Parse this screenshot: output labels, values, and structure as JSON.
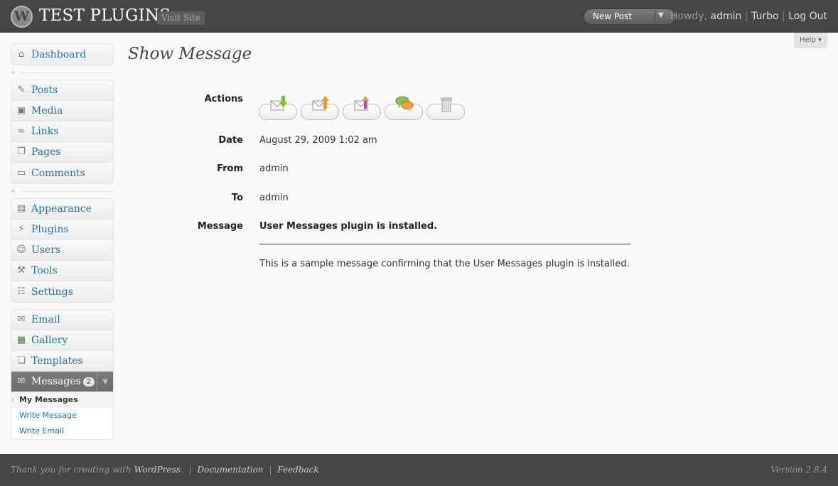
{
  "header": {
    "site_title": "TEST PLUGINS",
    "visit_site": "Visit Site",
    "new_post": "New Post",
    "howdy_prefix": "Howdy,",
    "user": "admin",
    "turbo": "Turbo",
    "logout": "Log Out"
  },
  "help": "Help ▾",
  "sidebar": {
    "dashboard": "Dashboard",
    "content": [
      "Posts",
      "Media",
      "Links",
      "Pages",
      "Comments"
    ],
    "admin": [
      "Appearance",
      "Plugins",
      "Users",
      "Tools",
      "Settings"
    ],
    "plugins": [
      "Email",
      "Gallery",
      "Templates"
    ],
    "messages": {
      "label": "Messages",
      "badge": "2",
      "submenu": [
        "My Messages",
        "Write Message",
        "Write Email"
      ]
    }
  },
  "main": {
    "title": "Show Message",
    "actions_label": "Actions",
    "date_label": "Date",
    "date_value": "August 29, 2009 1:02 am",
    "from_label": "From",
    "from_value": "admin",
    "to_label": "To",
    "to_value": "admin",
    "message_label": "Message",
    "subject": "User Messages plugin is installed.",
    "body": "This is a sample message confirming that the User Messages plugin is installed."
  },
  "footer": {
    "thanks": "Thank you for creating with",
    "wordpress": "WordPress",
    "documentation": "Documentation",
    "feedback": "Feedback",
    "version": "Version 2.8.4"
  },
  "icons": {
    "actions": [
      "inbox-download-icon",
      "reply-icon",
      "forward-icon",
      "chat-icon",
      "trash-icon"
    ]
  },
  "colors": {
    "header_bg": "#464646",
    "link": "#21759b",
    "active_menu": "#6d6d6d"
  }
}
